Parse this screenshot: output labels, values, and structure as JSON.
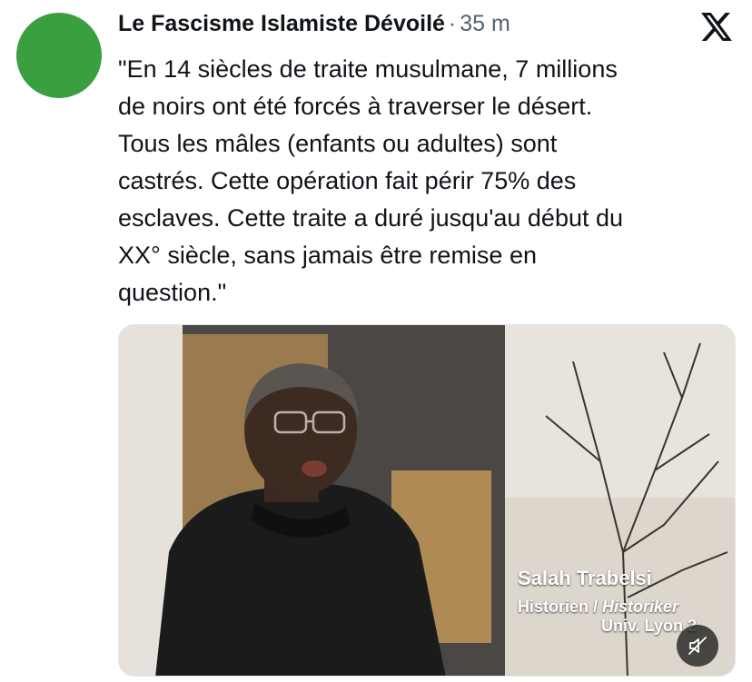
{
  "author": {
    "display_name": "Le Fascisme Islamiste Dévoilé",
    "separator": "·",
    "timestamp": "35 m",
    "avatar_color": "#3a9f3f"
  },
  "platform_icon": "x-logo-icon",
  "tweet": {
    "lines": [
      "\"En 14 siècles de traite musulmane, 7 millions",
      "de noirs ont été forcés à traverser le désert.",
      "Tous les mâles (enfants ou adultes) sont",
      "castrés. Cette opération fait périr 75% des",
      "esclaves. Cette traite a duré jusqu'au début du",
      "XX° siècle, sans jamais être remise en",
      "question.\""
    ]
  },
  "video": {
    "caption_name": "Salah Trabelsi",
    "caption_role": "Historien / ",
    "caption_role_italic": "Historiker",
    "caption_univ": "Univ. Lyon 2",
    "mute_icon": "speaker-muted-icon"
  }
}
